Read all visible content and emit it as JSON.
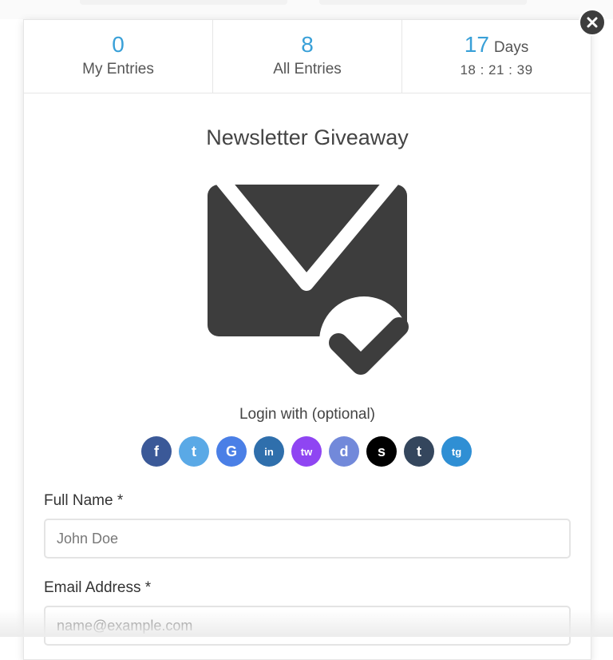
{
  "stats": {
    "my_entries": {
      "value": "0",
      "label": "My Entries"
    },
    "all_entries": {
      "value": "8",
      "label": "All Entries"
    },
    "countdown": {
      "days": "17",
      "days_label": "Days",
      "time": "18 : 21 : 39"
    }
  },
  "giveaway": {
    "title": "Newsletter Giveaway",
    "icon": "envelope-check-icon"
  },
  "login": {
    "label": "Login with (optional)",
    "providers": [
      {
        "name": "facebook",
        "glyph": "f",
        "color": "#3b5998"
      },
      {
        "name": "twitter",
        "glyph": "t",
        "color": "#5aa9e6"
      },
      {
        "name": "google",
        "glyph": "G",
        "color": "#4a7fe6"
      },
      {
        "name": "linkedin",
        "glyph": "in",
        "color": "#2f6fac"
      },
      {
        "name": "twitch",
        "glyph": "tw",
        "color": "#8f45f2"
      },
      {
        "name": "discord",
        "glyph": "d",
        "color": "#7289da"
      },
      {
        "name": "steam",
        "glyph": "s",
        "color": "#000000"
      },
      {
        "name": "tumblr",
        "glyph": "t",
        "color": "#34465d"
      },
      {
        "name": "telegram",
        "glyph": "tg",
        "color": "#2f8fd4"
      }
    ]
  },
  "form": {
    "full_name": {
      "label": "Full Name *",
      "placeholder": "John Doe"
    },
    "email": {
      "label": "Email Address *",
      "placeholder": "name@example.com"
    }
  },
  "colors": {
    "accent": "#39a0d8",
    "icon_dark": "#3d3d3d"
  }
}
